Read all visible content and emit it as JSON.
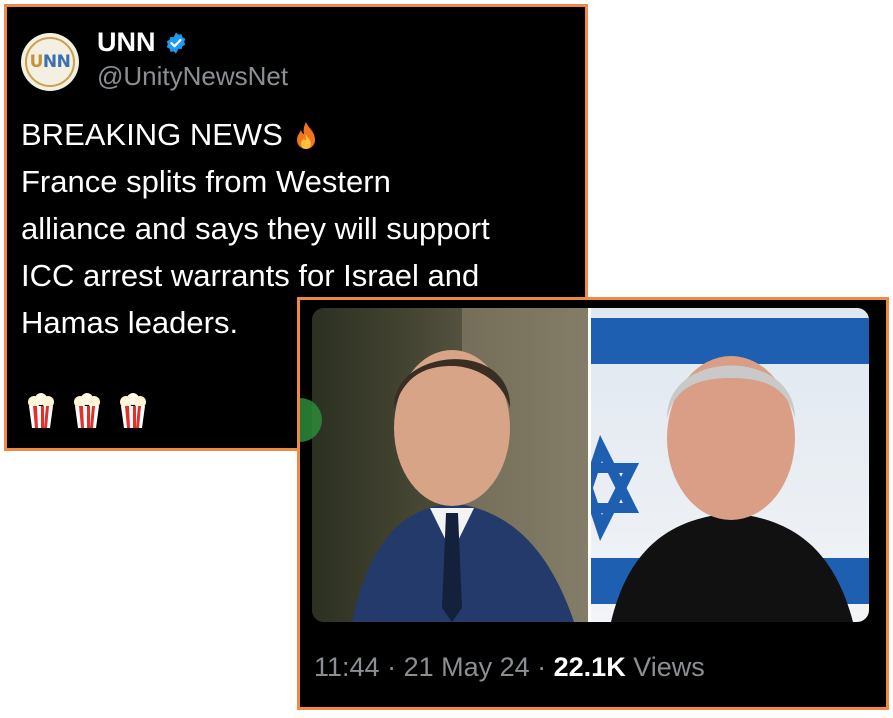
{
  "tweet": {
    "account_name": "UNN",
    "handle": "@UnityNewsNet",
    "avatar_text_left": "U",
    "avatar_text_right": "NN",
    "text_lines": [
      "BREAKING NEWS",
      "France splits from Western",
      "alliance and says they will support",
      "ICC arrest warrants for Israel and",
      "Hamas leaders."
    ],
    "emoji_count": 3
  },
  "media": {
    "time": "11:44",
    "separator_1": " · ",
    "date": "21 May 24",
    "separator_2": " · ",
    "views_count": "22.1K",
    "views_label": "Views"
  },
  "colors": {
    "border_accent": "#ef8a43",
    "card_background": "#000000",
    "secondary_text": "#8b8f94",
    "verified_blue": "#1d9bf0"
  },
  "icons": {
    "verified": "verified-badge-icon",
    "fire": "fire-emoji-icon",
    "popcorn": "popcorn-emoji-icon"
  }
}
